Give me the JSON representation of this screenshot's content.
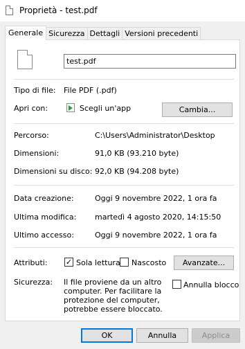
{
  "window": {
    "title": "Proprietà - test.pdf"
  },
  "tabs": [
    {
      "label": "Generale"
    },
    {
      "label": "Sicurezza"
    },
    {
      "label": "Dettagli"
    },
    {
      "label": "Versioni precedenti"
    }
  ],
  "general": {
    "file_name": "test.pdf",
    "type_label": "Tipo di file:",
    "type_value": "File PDF (.pdf)",
    "open_with_label": "Apri con:",
    "open_with_value": "Scegli un'app",
    "change_button": "Cambia...",
    "path_label": "Percorso:",
    "path_value": "C:\\Users\\Administrator\\Desktop",
    "size_label": "Dimensioni:",
    "size_value": "91,0 KB (93.210 byte)",
    "disk_size_label": "Dimensioni su disco:",
    "disk_size_value": "92,0 KB (94.208 byte)",
    "created_label": "Data creazione:",
    "created_value": "Oggi 9 novembre 2022, 1 ora fa",
    "modified_label": "Ultima modifica:",
    "modified_value": "martedì 4 agosto 2020, 14:15:50",
    "accessed_label": "Ultimo accesso:",
    "accessed_value": "Oggi 9 novembre 2022, 1 ora fa",
    "attributes_label": "Attributi:",
    "readonly_label": "Sola lettura",
    "readonly_checked": true,
    "hidden_label": "Nascosto",
    "hidden_checked": false,
    "advanced_button": "Avanzate...",
    "security_label": "Sicurezza:",
    "security_text": [
      "Il file proviene da un altro",
      "computer. Per facilitare la",
      "protezione del computer,",
      "potrebbe essere bloccato."
    ],
    "unblock_label": "Annulla blocco",
    "unblock_checked": false
  },
  "buttons": {
    "ok": "OK",
    "cancel": "Annulla",
    "apply": "Applica"
  },
  "icons": {
    "title": "document-icon",
    "file": "file-icon",
    "app": "app-icon"
  }
}
